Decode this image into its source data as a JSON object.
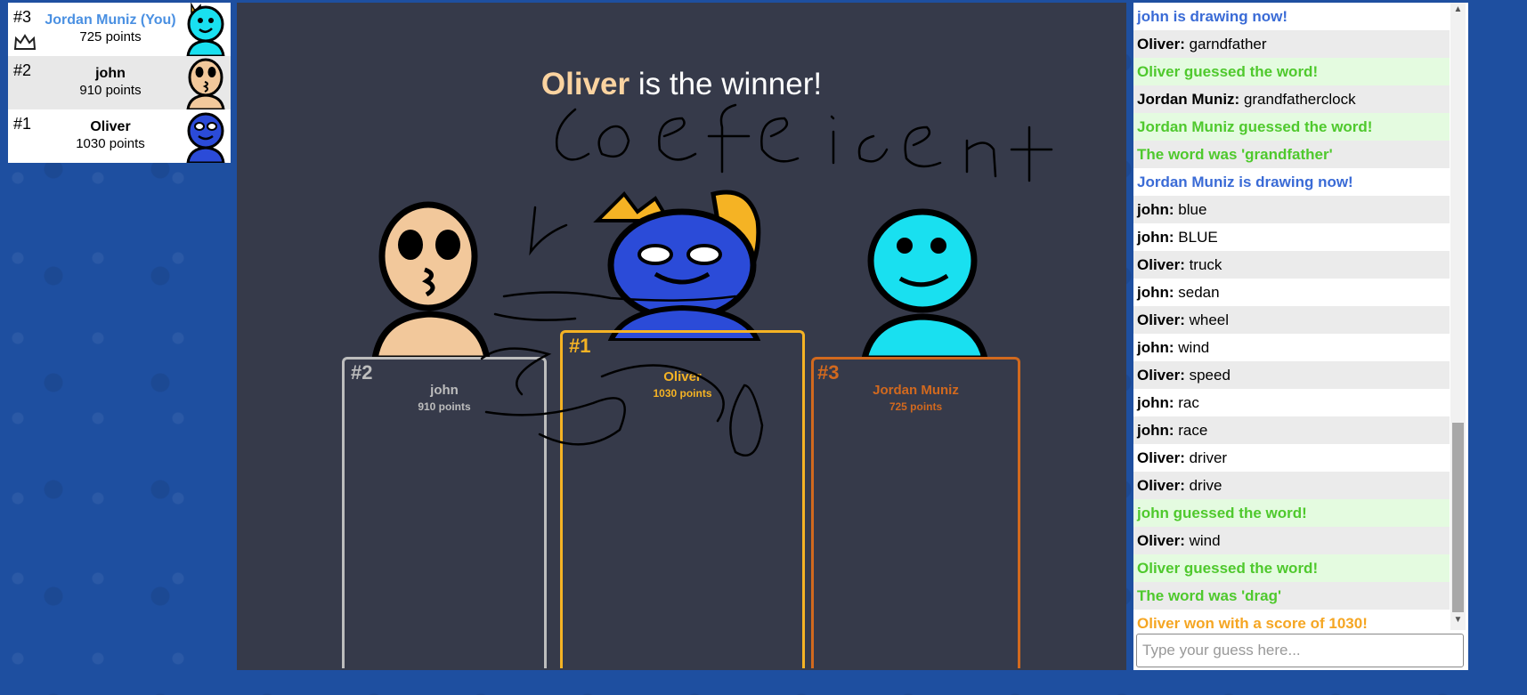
{
  "players": [
    {
      "rank": "#3",
      "name": "Jordan Muniz (You)",
      "points": "725 points",
      "you": true,
      "avatar": "cyan-face",
      "colors": {
        "skin": "#19e0f0"
      }
    },
    {
      "rank": "#2",
      "name": "john",
      "points": "910 points",
      "you": false,
      "avatar": "beige-face",
      "colors": {
        "skin": "#f2c89b"
      }
    },
    {
      "rank": "#1",
      "name": "Oliver",
      "points": "1030 points",
      "you": false,
      "avatar": "blue-face",
      "colors": {
        "skin": "#2b4bd8"
      }
    }
  ],
  "canvas": {
    "winner_name": "Oliver",
    "winner_suffix": " is the winner!",
    "podium": {
      "first": {
        "rank": "#1",
        "name": "Oliver",
        "points": "1030 points",
        "color": "#f5b324"
      },
      "second": {
        "rank": "#2",
        "name": "john",
        "points": "910 points",
        "color": "#bdbdbd"
      },
      "third": {
        "rank": "#3",
        "name": "Jordan Muniz",
        "points": "725 points",
        "color": "#d2691e"
      }
    }
  },
  "chat": {
    "messages": [
      {
        "type": "drawing",
        "text": "john is drawing now!"
      },
      {
        "type": "msg",
        "author": "Oliver:",
        "text": " garndfather"
      },
      {
        "type": "guess",
        "text": "Oliver guessed the word!"
      },
      {
        "type": "msg",
        "author": "Jordan Muniz:",
        "text": " grandfatherclock"
      },
      {
        "type": "guess",
        "text": "Jordan Muniz guessed the word!"
      },
      {
        "type": "reveal",
        "text": "The word was 'grandfather'"
      },
      {
        "type": "drawing",
        "text": "Jordan Muniz is drawing now!"
      },
      {
        "type": "msg",
        "author": "john:",
        "text": " blue"
      },
      {
        "type": "msg",
        "author": "john:",
        "text": " BLUE"
      },
      {
        "type": "msg",
        "author": "Oliver:",
        "text": " truck"
      },
      {
        "type": "msg",
        "author": "john:",
        "text": " sedan"
      },
      {
        "type": "msg",
        "author": "Oliver:",
        "text": " wheel"
      },
      {
        "type": "msg",
        "author": "john:",
        "text": " wind"
      },
      {
        "type": "msg",
        "author": "Oliver:",
        "text": " speed"
      },
      {
        "type": "msg",
        "author": "john:",
        "text": " rac"
      },
      {
        "type": "msg",
        "author": "john:",
        "text": " race"
      },
      {
        "type": "msg",
        "author": "Oliver:",
        "text": " driver"
      },
      {
        "type": "msg",
        "author": "Oliver:",
        "text": " drive"
      },
      {
        "type": "guess",
        "text": "john guessed the word!"
      },
      {
        "type": "msg",
        "author": "Oliver:",
        "text": " wind"
      },
      {
        "type": "guess",
        "text": "Oliver guessed the word!"
      },
      {
        "type": "reveal",
        "text": "The word was 'drag'"
      },
      {
        "type": "won",
        "text": "Oliver won with a score of 1030!"
      }
    ],
    "input_placeholder": "Type your guess here..."
  }
}
